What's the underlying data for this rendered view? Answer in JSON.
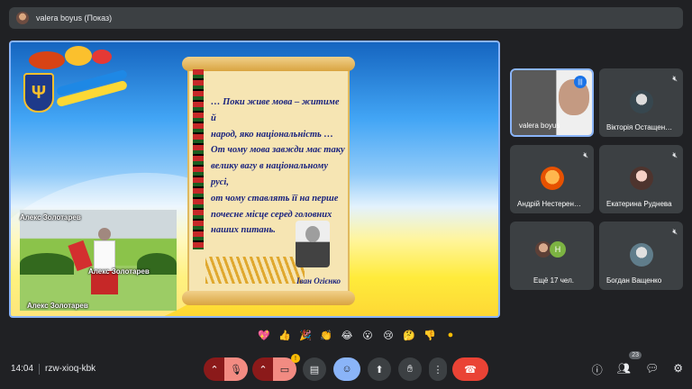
{
  "header": {
    "presenter_title": "valera boyus (Показ)"
  },
  "slide": {
    "poem_lines": [
      "… Поки живе мова – житиме й",
      "народ, яко національність …",
      "От чому мова завжди має таку",
      "велику вагу в національному русі,",
      "от чому ставлять її на перше",
      "почесне місце серед головних",
      "наших питань."
    ],
    "signature": "Іван Огієнко"
  },
  "overlay_names": [
    "Алекс Золотарев",
    "Алекс Золотарев",
    "Алекс Золотарев"
  ],
  "participants": [
    {
      "name": "valera boyus"
    },
    {
      "name": "Вікторія Остащен…"
    },
    {
      "name": "Андрій Нестерен…"
    },
    {
      "name": "Екатерина Руднева"
    },
    {
      "name": "Ещё 17 чел."
    },
    {
      "name": "Богдан Ващенко"
    }
  ],
  "more_initial": "Н",
  "reactions": [
    "💖",
    "👍",
    "🎉",
    "👏",
    "😂",
    "😮",
    "😢",
    "🤔",
    "👎"
  ],
  "footer": {
    "time": "14:04",
    "meeting_code": "rzw-xioq-kbk",
    "people_count": "23",
    "warning_badge": "!"
  },
  "colors": {
    "accent": "#8ab4f8",
    "end_call": "#ea4335",
    "background": "#202124"
  }
}
